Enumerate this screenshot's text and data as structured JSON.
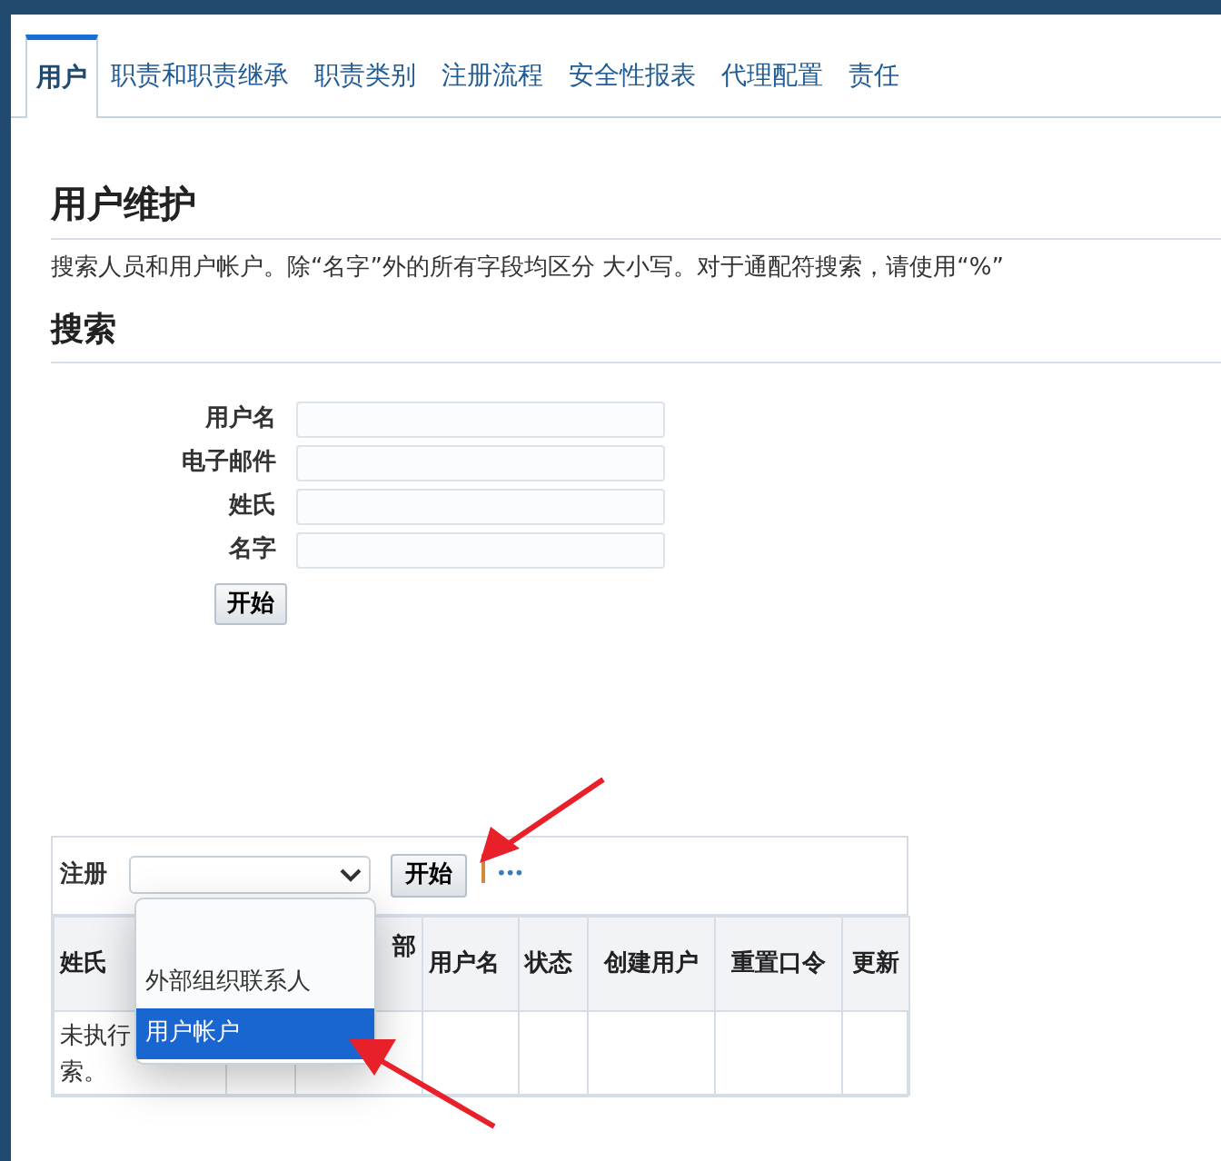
{
  "tabs": [
    {
      "label": "用户",
      "selected": true
    },
    {
      "label": "职责和职责继承",
      "selected": false
    },
    {
      "label": "职责类别",
      "selected": false
    },
    {
      "label": "注册流程",
      "selected": false
    },
    {
      "label": "安全性报表",
      "selected": false
    },
    {
      "label": "代理配置",
      "selected": false
    },
    {
      "label": "责任",
      "selected": false
    }
  ],
  "page_title": "用户维护",
  "description": "搜索人员和用户帐户。除“名字”外的所有字段均区分 大小写。对于通配符搜索，请使用“%”",
  "search_title": "搜索",
  "search_fields": [
    {
      "label": "用户名"
    },
    {
      "label": "电子邮件"
    },
    {
      "label": "姓氏"
    },
    {
      "label": "名字"
    }
  ],
  "search_button": "开始",
  "results": {
    "register_label": "注册",
    "go_button": "开始",
    "more": "•••",
    "dropdown_options": [
      {
        "label": "外部组织联系人",
        "selected": false
      },
      {
        "label": "用户帐户",
        "selected": true
      }
    ],
    "columns": [
      "姓氏",
      "部",
      "用户名",
      "状态",
      "创建用户",
      "重置口令",
      "更新"
    ],
    "empty_message": [
      "未执行",
      "索。"
    ]
  }
}
